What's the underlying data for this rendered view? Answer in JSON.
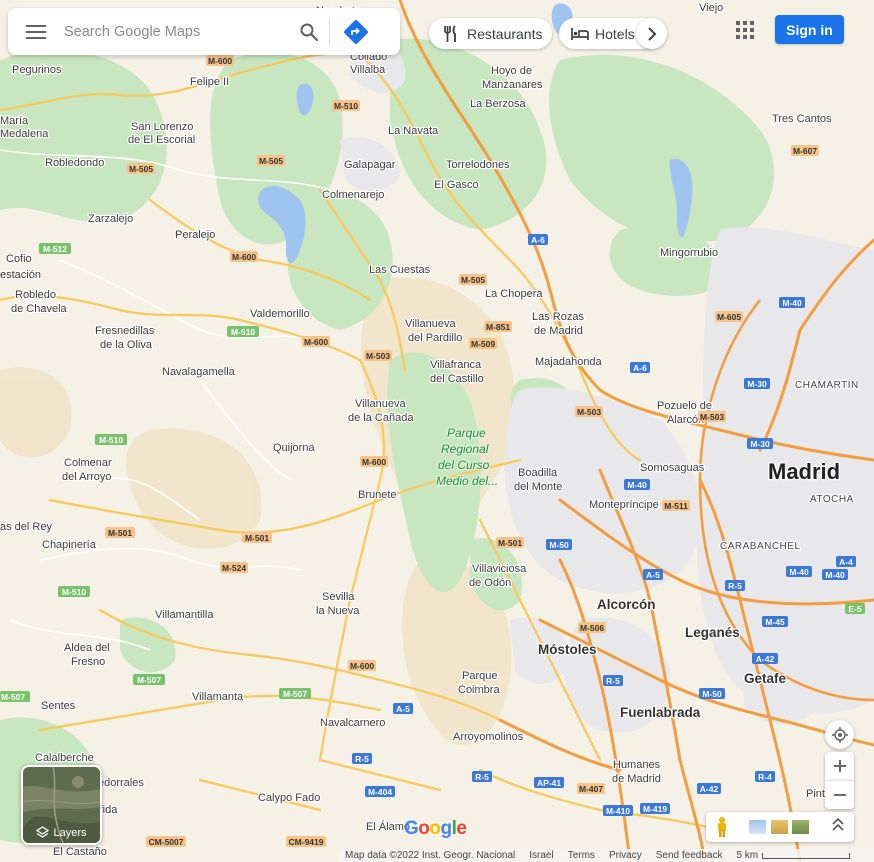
{
  "search": {
    "placeholder": "Search Google Maps"
  },
  "chips": [
    {
      "label": "Restaurants",
      "icon": "fork-knife-icon"
    },
    {
      "label": "Hotels",
      "icon": "bed-icon"
    }
  ],
  "header": {
    "sign_in": "Sign in"
  },
  "layers": {
    "label": "Layers"
  },
  "footer": {
    "map_data": "Map data ©2022 Inst. Geogr. Nacional",
    "region": "Israel",
    "terms": "Terms",
    "privacy": "Privacy",
    "feedback": "Send feedback",
    "scale": "5 km"
  },
  "logo": {
    "text": "Google"
  },
  "colors": {
    "accent": "#1a73e8",
    "park": "#c8e6c0",
    "land": "#f5f1e6",
    "urban": "#e8e8ea",
    "road": "#f7c85a"
  },
  "map": {
    "places": [
      {
        "name": "Alpedrete"
      },
      {
        "name": "Viejo"
      },
      {
        "name": "Pegurinos"
      },
      {
        "name": "Felipe II"
      },
      {
        "name": "Collado Villalba"
      },
      {
        "name": "Hoyo de Manzanares"
      },
      {
        "name": "La Berzosa"
      },
      {
        "name": "María Medalena"
      },
      {
        "name": "San Lorenzo de El Escorial"
      },
      {
        "name": "La Navata"
      },
      {
        "name": "Tres Cantos"
      },
      {
        "name": "Robledondo"
      },
      {
        "name": "Galapagar"
      },
      {
        "name": "Torrelodones"
      },
      {
        "name": "Colmenarejo"
      },
      {
        "name": "El Gasco"
      },
      {
        "name": "Zarzalejo"
      },
      {
        "name": "Peralejo"
      },
      {
        "name": "Cofio"
      },
      {
        "name": "estación"
      },
      {
        "name": "Las Cuestas"
      },
      {
        "name": "Mingorrubio"
      },
      {
        "name": "La Chopera"
      },
      {
        "name": "Robledo de Chavela"
      },
      {
        "name": "Valdemorillo"
      },
      {
        "name": "Las Rozas de Madrid"
      },
      {
        "name": "Fresnedillas de la Oliva"
      },
      {
        "name": "Villanueva del Pardillo"
      },
      {
        "name": "Majadahonda"
      },
      {
        "name": "Navalagamella"
      },
      {
        "name": "Villafranca del Castillo"
      },
      {
        "name": "Villanueva de la Cañada"
      },
      {
        "name": "Pozuelo de Alarcón"
      },
      {
        "name": "CHAMARTÍN"
      },
      {
        "name": "Quijorna"
      },
      {
        "name": "Colmenar del Arroyo"
      },
      {
        "name": "Boadilla del Monte"
      },
      {
        "name": "Somosaguas"
      },
      {
        "name": "Madrid"
      },
      {
        "name": "Brunete"
      },
      {
        "name": "Montepríncipe"
      },
      {
        "name": "ATOCHA"
      },
      {
        "name": "as del Rey"
      },
      {
        "name": "Chapinería"
      },
      {
        "name": "Villaviciosa de Odón"
      },
      {
        "name": "CARABANCHEL"
      },
      {
        "name": "Sevilla la Nueva"
      },
      {
        "name": "Alcorcón"
      },
      {
        "name": "Villamantilla"
      },
      {
        "name": "Leganés"
      },
      {
        "name": "Aldea del Fresno"
      },
      {
        "name": "Móstoles"
      },
      {
        "name": "Getafe"
      },
      {
        "name": "Villamanta"
      },
      {
        "name": "Parque Coimbra"
      },
      {
        "name": "Fuenlabrada"
      },
      {
        "name": "Navalcarnero"
      },
      {
        "name": "Arroyomolinos"
      },
      {
        "name": "Humanes de Madrid"
      },
      {
        "name": "Calalberche"
      },
      {
        "name": "edorrales"
      },
      {
        "name": "Calypo Fado"
      },
      {
        "name": "El Álamo"
      },
      {
        "name": "rida"
      },
      {
        "name": "El Castaño"
      },
      {
        "name": "Pinto"
      },
      {
        "name": "Sentes"
      }
    ],
    "park_name": "Parque Regional del Curso Medio del...",
    "roads": [
      "M-600",
      "M-510",
      "M-505",
      "M-512",
      "M-600",
      "M-510",
      "M-505",
      "M-503",
      "M-509",
      "M-851",
      "A-6",
      "M-40",
      "M-605",
      "M-503",
      "M-30",
      "M-40",
      "M-511",
      "M-501",
      "M-50",
      "A-5",
      "R-5",
      "M-40",
      "M-40",
      "A-4",
      "E-5",
      "M-506",
      "M-45",
      "A-42",
      "R-5",
      "M-50",
      "M-524",
      "M-600",
      "M-507",
      "M-507",
      "A-5",
      "R-5",
      "M-404",
      "M-407",
      "M-410",
      "M-419",
      "A-42",
      "R-4",
      "AP-41",
      "CM-5007",
      "CM-9419"
    ]
  }
}
